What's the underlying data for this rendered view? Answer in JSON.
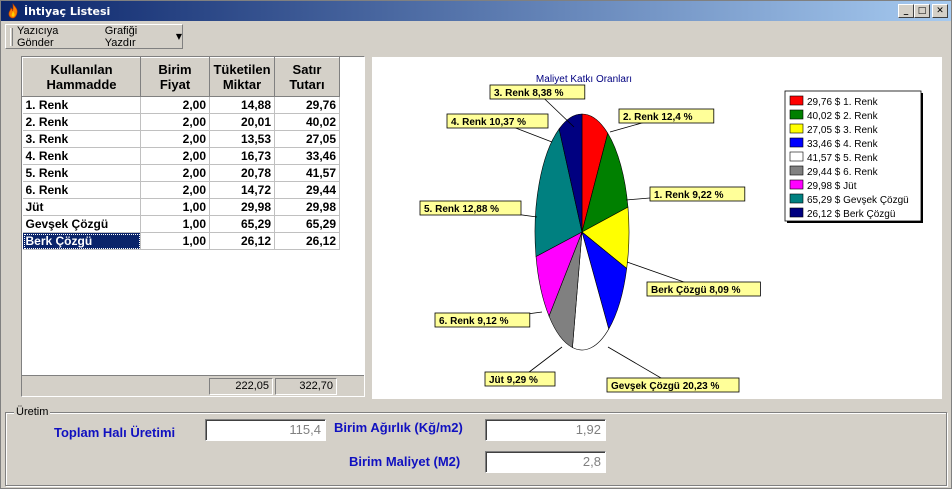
{
  "window": {
    "title": "İhtiyaç Listesi"
  },
  "toolbar": {
    "send_to_printer": "Yazıcıya Gönder",
    "print_chart": "Grafiği Yazdır"
  },
  "grid": {
    "headers": [
      "Kullanılan Hammadde",
      "Birim Fiyat",
      "Tüketilen Miktar",
      "Satır Tutarı"
    ],
    "header_lines": [
      [
        "Kullanılan",
        "Hammadde"
      ],
      [
        "Birim",
        "Fiyat"
      ],
      [
        "Tüketilen",
        "Miktar"
      ],
      [
        "Satır",
        "Tutarı"
      ]
    ],
    "rows": [
      {
        "name": "1. Renk",
        "price": "2,00",
        "qty": "14,88",
        "total": "29,76"
      },
      {
        "name": "2. Renk",
        "price": "2,00",
        "qty": "20,01",
        "total": "40,02"
      },
      {
        "name": "3. Renk",
        "price": "2,00",
        "qty": "13,53",
        "total": "27,05"
      },
      {
        "name": "4. Renk",
        "price": "2,00",
        "qty": "16,73",
        "total": "33,46"
      },
      {
        "name": "5. Renk",
        "price": "2,00",
        "qty": "20,78",
        "total": "41,57"
      },
      {
        "name": "6. Renk",
        "price": "2,00",
        "qty": "14,72",
        "total": "29,44"
      },
      {
        "name": "Jüt",
        "price": "1,00",
        "qty": "29,98",
        "total": "29,98"
      },
      {
        "name": "Gevşek Çözgü",
        "price": "1,00",
        "qty": "65,29",
        "total": "65,29"
      },
      {
        "name": "Berk Çözgü",
        "price": "1,00",
        "qty": "26,12",
        "total": "26,12"
      }
    ],
    "selected_row": 8,
    "footer": {
      "qty_total": "222,05",
      "amount_total": "322,70"
    }
  },
  "chart_data": {
    "type": "pie",
    "title": "Maliyet Katkı Oranları",
    "slices": [
      {
        "label": "1. Renk",
        "value": 29.76,
        "percent_label": "1. Renk 9,22 %",
        "legend": "29,76 $ 1. Renk",
        "color": "#ff0000"
      },
      {
        "label": "2. Renk",
        "value": 40.02,
        "percent_label": "2. Renk 12,4 %",
        "legend": "40,02 $ 2. Renk",
        "color": "#008000"
      },
      {
        "label": "3. Renk",
        "value": 27.05,
        "percent_label": "3. Renk 8,38 %",
        "legend": "27,05 $ 3. Renk",
        "color": "#ffff00"
      },
      {
        "label": "4. Renk",
        "value": 33.46,
        "percent_label": "4. Renk 10,37 %",
        "legend": "33,46 $ 4. Renk",
        "color": "#0000ff"
      },
      {
        "label": "5. Renk",
        "value": 41.57,
        "percent_label": "5. Renk 12,88 %",
        "legend": "41,57 $ 5. Renk",
        "color": "#ffffff"
      },
      {
        "label": "6. Renk",
        "value": 29.44,
        "percent_label": "6. Renk 9,12 %",
        "legend": "29,44 $ 6. Renk",
        "color": "#808080"
      },
      {
        "label": "Jüt",
        "value": 29.98,
        "percent_label": "Jüt 9,29 %",
        "legend": "29,98 $ Jüt",
        "color": "#ff00ff"
      },
      {
        "label": "Gevşek Çözgü",
        "value": 65.29,
        "percent_label": "Gevşek Çözgü 20,23 %",
        "legend": "65,29 $ Gevşek Çözgü",
        "color": "#008080"
      },
      {
        "label": "Berk Çözgü",
        "value": 26.12,
        "percent_label": "Berk Çözgü 8,09 %",
        "legend": "26,12 $ Berk Çözgü",
        "color": "#000080"
      }
    ],
    "legend_placement": "top-right",
    "label_box_color": "#ffff99"
  },
  "production": {
    "group_label": "Üretim",
    "total_label": "Toplam Halı Üretimi",
    "total_value": "115,4",
    "unit_weight_label": "Birim Ağırlık (Kğ/m2)",
    "unit_weight_value": "1,92",
    "unit_cost_label": "Birim Maliyet (M2)",
    "unit_cost_value": "2,8"
  }
}
